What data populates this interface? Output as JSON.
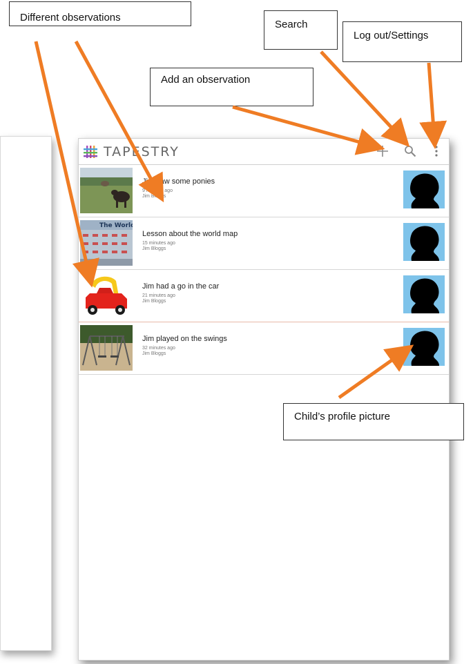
{
  "app": {
    "brand": "TAPESTRY"
  },
  "toolbar": {
    "add_icon": "plus-icon",
    "search_icon": "search-icon",
    "more_icon": "overflow-menu-icon"
  },
  "observations": [
    {
      "title": "Jim saw some ponies",
      "time": "9 minutes ago",
      "author": "Jim Bloggs",
      "thumb": "ponies-photo"
    },
    {
      "title": "Lesson about the world map",
      "time": "15 minutes ago",
      "author": "Jim Bloggs",
      "thumb": "world-map-photo",
      "thumb_text": "The World"
    },
    {
      "title": "Jim had a go in the car",
      "time": "21 minutes ago",
      "author": "Jim Bloggs",
      "thumb": "toy-car-photo"
    },
    {
      "title": "Jim played on the swings",
      "time": "32 minutes ago",
      "author": "Jim Bloggs",
      "thumb": "swings-photo"
    }
  ],
  "annotations": {
    "different_observations": "Different observations",
    "search": "Search",
    "logout_settings": "Log out/Settings",
    "add_observation": "Add an observation",
    "profile_picture": "Child’s profile picture"
  },
  "colors": {
    "arrow": "#ef7c24",
    "avatar_bg": "#7ec3ea",
    "brand_logo": "#8a4fb6"
  }
}
